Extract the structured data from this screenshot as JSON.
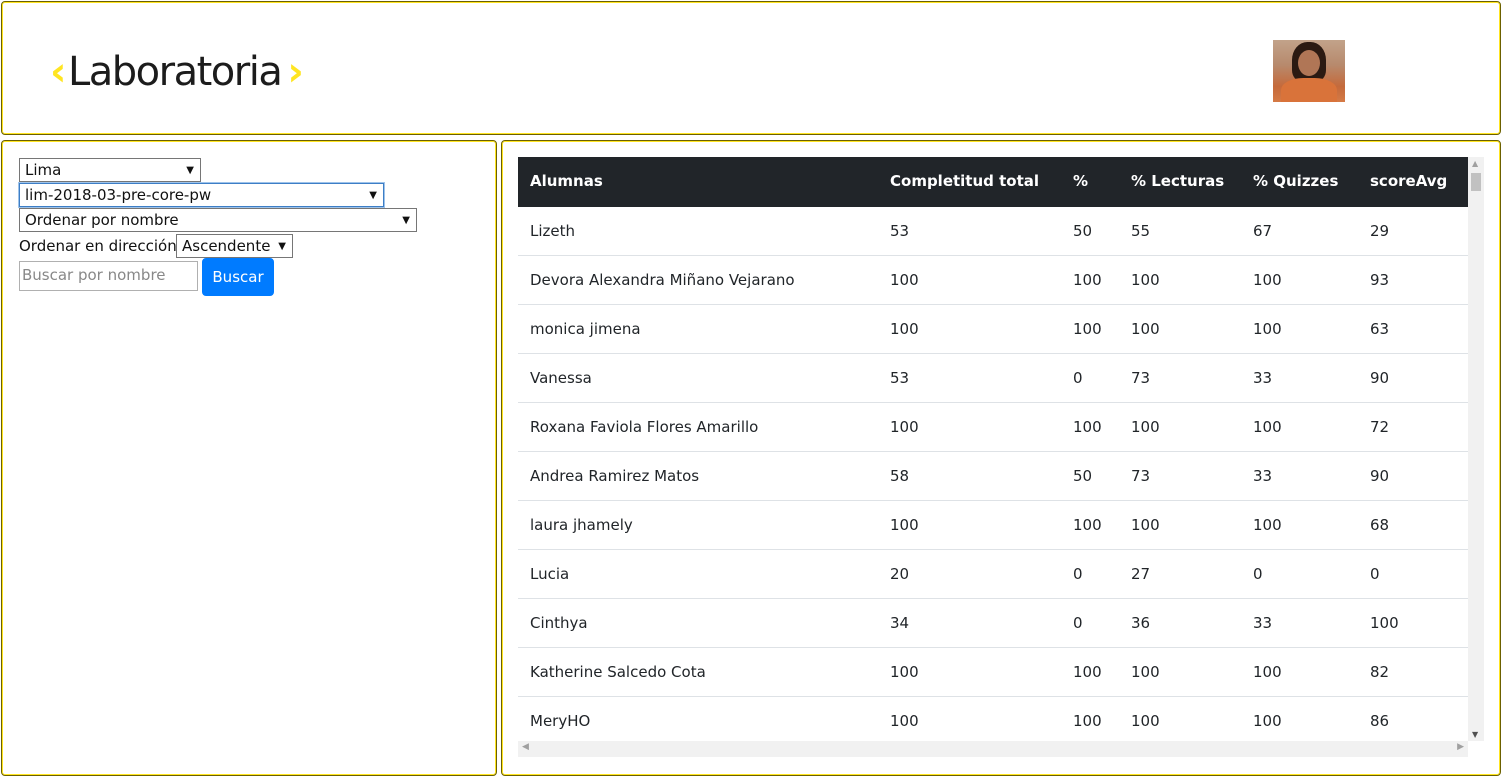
{
  "header": {
    "logo_text": "Laboratoria",
    "logo_left": "‹",
    "logo_right": "›",
    "accent": "#ffe521"
  },
  "filters": {
    "sede": "Lima",
    "cohort": "lim-2018-03-pre-core-pw",
    "order_by": "Ordenar por nombre",
    "direction_label": "Ordenar en dirección:",
    "direction": "Ascendente",
    "search_placeholder": "Buscar por nombre",
    "search_button": "Buscar",
    "button_color": "#007bff"
  },
  "table": {
    "headers": [
      "Alumnas",
      "Completitud total",
      "%",
      "% Lecturas",
      "% Quizzes",
      "scoreAvg"
    ],
    "rows": [
      [
        "Lizeth",
        "53",
        "50",
        "55",
        "67",
        "29"
      ],
      [
        "Devora Alexandra Miñano Vejarano",
        "100",
        "100",
        "100",
        "100",
        "93"
      ],
      [
        "monica jimena",
        "100",
        "100",
        "100",
        "100",
        "63"
      ],
      [
        "Vanessa",
        "53",
        "0",
        "73",
        "33",
        "90"
      ],
      [
        "Roxana Faviola Flores Amarillo",
        "100",
        "100",
        "100",
        "100",
        "72"
      ],
      [
        "Andrea Ramirez Matos",
        "58",
        "50",
        "73",
        "33",
        "90"
      ],
      [
        "laura jhamely",
        "100",
        "100",
        "100",
        "100",
        "68"
      ],
      [
        "Lucia",
        "20",
        "0",
        "27",
        "0",
        "0"
      ],
      [
        "Cinthya",
        "34",
        "0",
        "36",
        "33",
        "100"
      ],
      [
        "Katherine Salcedo Cota",
        "100",
        "100",
        "100",
        "100",
        "82"
      ],
      [
        "MeryHO",
        "100",
        "100",
        "100",
        "100",
        "86"
      ]
    ]
  }
}
